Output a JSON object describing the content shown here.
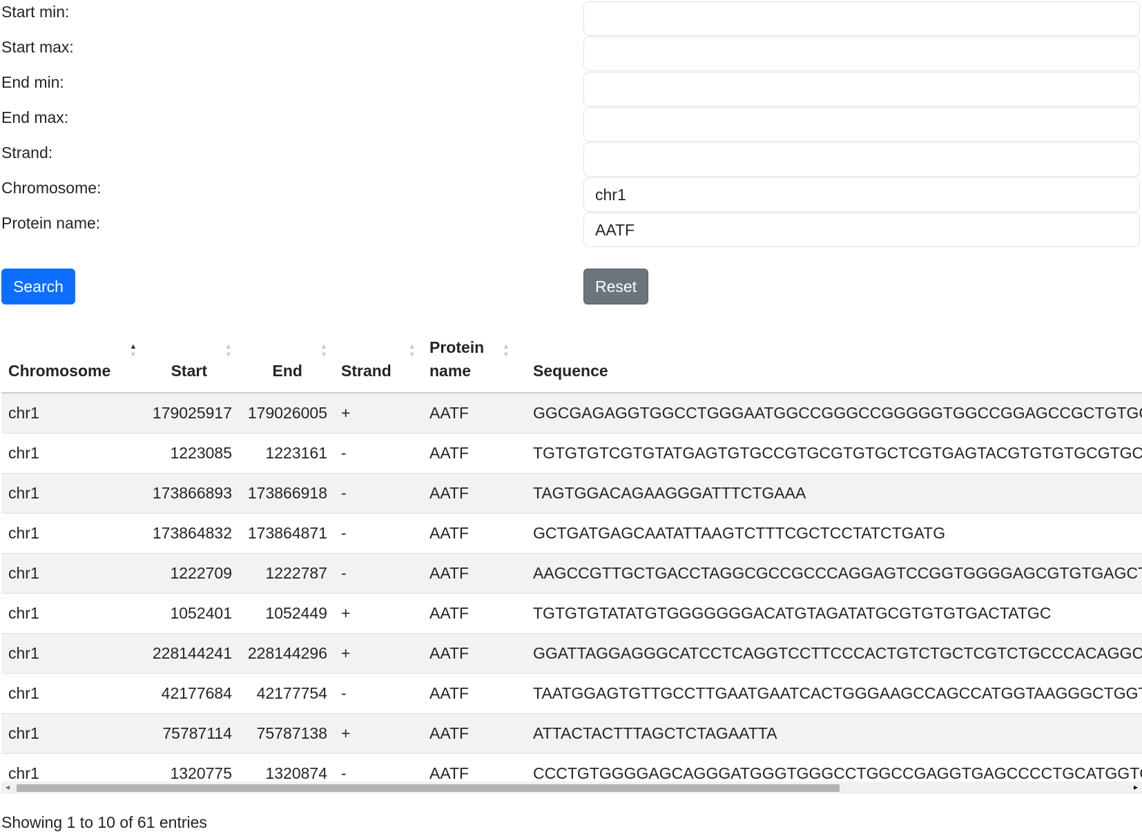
{
  "filters": [
    {
      "label": "Start min:",
      "value": "",
      "name": "start-min"
    },
    {
      "label": "Start max:",
      "value": "",
      "name": "start-max"
    },
    {
      "label": "End min:",
      "value": "",
      "name": "end-min"
    },
    {
      "label": "End max:",
      "value": "",
      "name": "end-max"
    },
    {
      "label": "Strand:",
      "value": "",
      "name": "strand"
    },
    {
      "label": "Chromosome:",
      "value": "chr1",
      "name": "chromosome"
    },
    {
      "label": "Protein name:",
      "value": "AATF",
      "name": "protein-name"
    }
  ],
  "buttons": {
    "search": "Search",
    "reset": "Reset"
  },
  "colors": {
    "primary": "#0d6efd",
    "secondary": "#6c757d",
    "stripe": "#f2f2f2"
  },
  "table": {
    "headers": {
      "chromosome": "Chromosome",
      "start": "Start",
      "end": "End",
      "strand": "Strand",
      "protein_line1": "Protein",
      "protein_line2": "name",
      "sequence": "Sequence"
    },
    "sort_column": "Chromosome",
    "sort_direction": "ascending",
    "rows": [
      {
        "chromosome": "chr1",
        "start": "179025917",
        "end": "179026005",
        "strand": "+",
        "protein": "AATF",
        "sequence": "GGCGAGAGGTGGCCTGGGAATGGCCGGGCCGGGGGTGGCCGGAGCCGCTGTGGCGGCG"
      },
      {
        "chromosome": "chr1",
        "start": "1223085",
        "end": "1223161",
        "strand": "-",
        "protein": "AATF",
        "sequence": "TGTGTGTCGTGTATGAGTGTGCCGTGCGTGTGCTCGTGAGTACGTGTGTGCGTGCCGTGTGTA"
      },
      {
        "chromosome": "chr1",
        "start": "173866893",
        "end": "173866918",
        "strand": "-",
        "protein": "AATF",
        "sequence": "TAGTGGACAGAAGGGATTTCTGAAA"
      },
      {
        "chromosome": "chr1",
        "start": "173864832",
        "end": "173864871",
        "strand": "-",
        "protein": "AATF",
        "sequence": "GCTGATGAGCAATATTAAGTCTTTCGCTCCTATCTGATG"
      },
      {
        "chromosome": "chr1",
        "start": "1222709",
        "end": "1222787",
        "strand": "-",
        "protein": "AATF",
        "sequence": "AAGCCGTTGCTGACCTAGGCGCCGCCCAGGAGTCCGGTGGGGAGCGTGTGAGCTGTGCCTG"
      },
      {
        "chromosome": "chr1",
        "start": "1052401",
        "end": "1052449",
        "strand": "+",
        "protein": "AATF",
        "sequence": "TGTGTGTATATGTGGGGGGGACATGTAGATATGCGTGTGTGACTATGC"
      },
      {
        "chromosome": "chr1",
        "start": "228144241",
        "end": "228144296",
        "strand": "+",
        "protein": "AATF",
        "sequence": "GGATTAGGAGGGCATCCTCAGGTCCTTCCCACTGTCTGCTCGTCTGCCCACAGGC"
      },
      {
        "chromosome": "chr1",
        "start": "42177684",
        "end": "42177754",
        "strand": "-",
        "protein": "AATF",
        "sequence": "TAATGGAGTGTTGCCTTGAATGAATCACTGGGAAGCCAGCCATGGTAAGGGCTGGTGAGGTT"
      },
      {
        "chromosome": "chr1",
        "start": "75787114",
        "end": "75787138",
        "strand": "+",
        "protein": "AATF",
        "sequence": "ATTACTACTTTAGCTCTAGAATTA"
      },
      {
        "chromosome": "chr1",
        "start": "1320775",
        "end": "1320874",
        "strand": "-",
        "protein": "AATF",
        "sequence": "CCCTGTGGGGAGCAGGGATGGGTGGGCCTGGCCGAGGTGAGCCCCTGCATGGTGGGGTCC"
      }
    ]
  },
  "scrollbar": {
    "left_arrow": "◂",
    "right_arrow": "▸"
  },
  "info": "Showing 1 to 10 of 61 entries"
}
